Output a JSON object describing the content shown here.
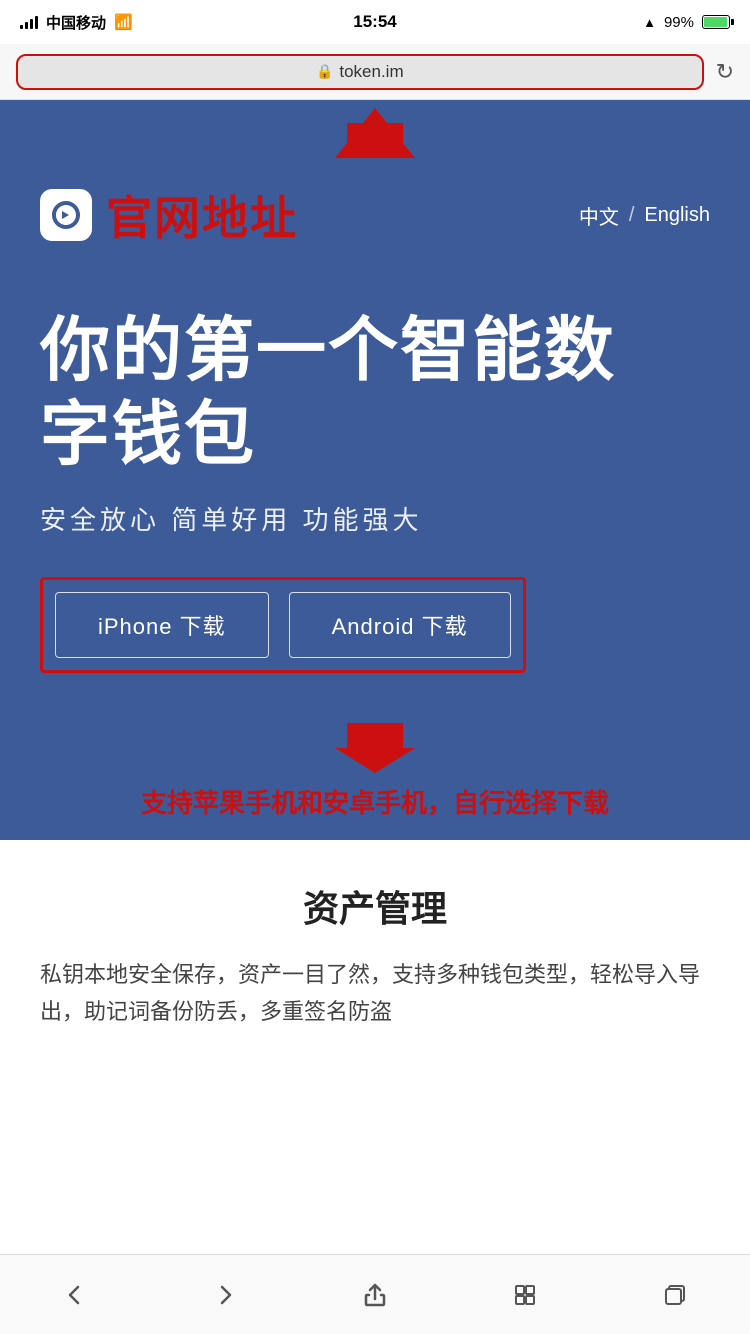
{
  "statusBar": {
    "carrier": "中国移动",
    "time": "15:54",
    "battery": "99%",
    "batteryIcon": "battery"
  },
  "browserBar": {
    "url": "token.im",
    "lockIcon": "🔒",
    "refreshIcon": "↻"
  },
  "arrowAnnotation": {
    "urlArrowLabel": "url-arrow"
  },
  "header": {
    "logoIcon": "e",
    "title": "官网地址",
    "langChinese": "中文",
    "langDivider": "/",
    "langEnglish": "English"
  },
  "hero": {
    "title": "你的第一个智能数\n字钱包",
    "subtitle": "安全放心  简单好用  功能强大",
    "iPhoneButton": "iPhone 下载",
    "androidButton": "Android 下载"
  },
  "annotation": {
    "text": "支持苹果手机和安卓手机，自行选择下载"
  },
  "assetSection": {
    "title": "资产管理",
    "body": "私钥本地安全保存，资产一目了然，支持多种钱包类型，轻松导入导出，助记词备份防丢，多重签名防盗"
  },
  "bottomNav": {
    "backIcon": "‹",
    "forwardIcon": "›",
    "shareIcon": "⬆",
    "bookmarkIcon": "⊞",
    "tabsIcon": "⧉"
  }
}
